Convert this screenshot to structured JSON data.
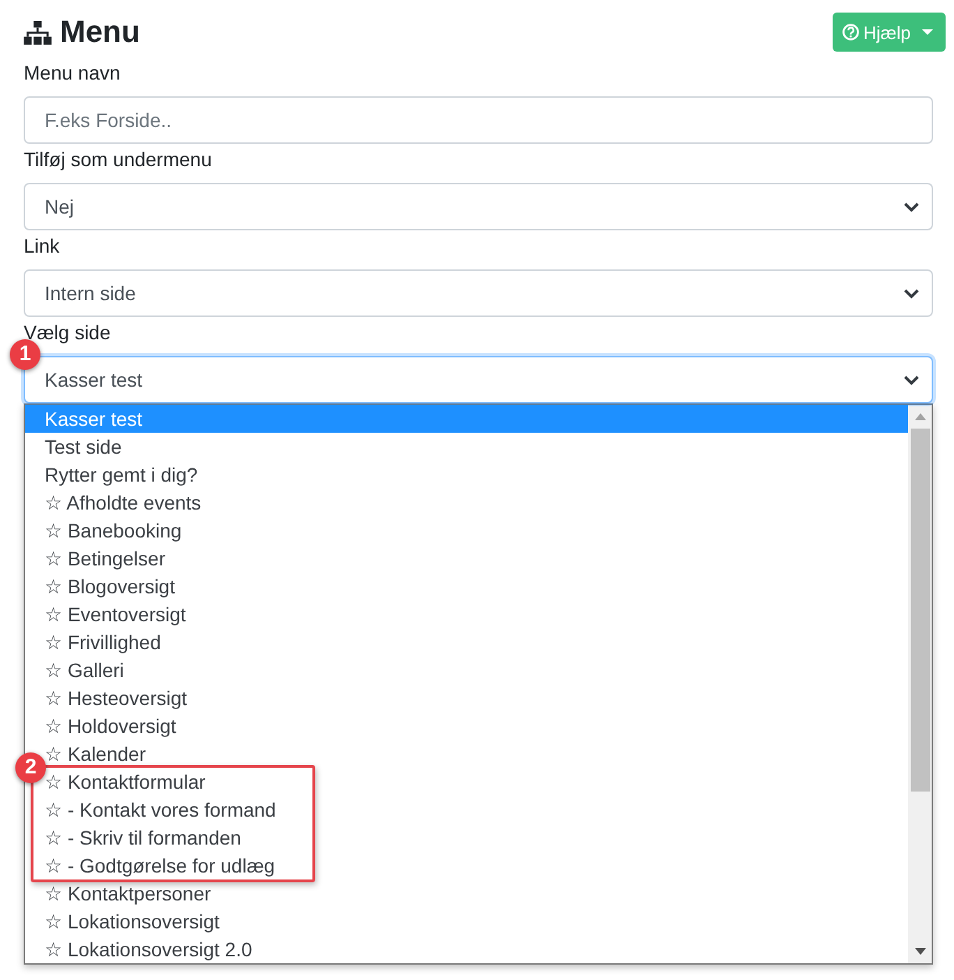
{
  "header": {
    "title": "Menu",
    "help_button": "Hjælp"
  },
  "fields": [
    {
      "kind": "input",
      "label": "Menu navn",
      "placeholder": "F.eks Forside..",
      "focused": false
    },
    {
      "kind": "select",
      "label": "Tilføj som undermenu",
      "value": "Nej",
      "focused": false
    },
    {
      "kind": "select",
      "label": "Link",
      "value": "Intern side",
      "focused": false
    },
    {
      "kind": "select",
      "label": "Vælg side",
      "value": "Kasser test",
      "focused": true,
      "badge": "1",
      "options": [
        {
          "kind": "option",
          "label": "Kasser test",
          "selected": true
        },
        {
          "kind": "option",
          "label": "Test side",
          "selected": false
        },
        {
          "kind": "option",
          "label": "Rytter gemt i dig?",
          "selected": false
        },
        {
          "kind": "option",
          "label": "☆ Afholdte events",
          "selected": false
        },
        {
          "kind": "option",
          "label": "☆ Banebooking",
          "selected": false
        },
        {
          "kind": "option",
          "label": "☆ Betingelser",
          "selected": false
        },
        {
          "kind": "option",
          "label": "☆ Blogoversigt",
          "selected": false
        },
        {
          "kind": "option",
          "label": "☆ Eventoversigt",
          "selected": false
        },
        {
          "kind": "option",
          "label": "☆ Frivillighed",
          "selected": false
        },
        {
          "kind": "option",
          "label": "☆ Galleri",
          "selected": false
        },
        {
          "kind": "option",
          "label": "☆ Hesteoversigt",
          "selected": false
        },
        {
          "kind": "option",
          "label": "☆ Holdoversigt",
          "selected": false
        },
        {
          "kind": "option",
          "label": "☆ Kalender",
          "selected": false
        },
        {
          "kind": "group",
          "highlighted": true,
          "badge": "2",
          "options": [
            {
              "kind": "option",
              "label": "☆ Kontaktformular",
              "selected": false
            },
            {
              "kind": "option",
              "label": "☆ - Kontakt vores formand",
              "selected": false
            },
            {
              "kind": "option",
              "label": "☆ - Skriv til formanden",
              "selected": false
            },
            {
              "kind": "option",
              "label": "☆ - Godtgørelse for udlæg",
              "selected": false
            }
          ]
        },
        {
          "kind": "option",
          "label": "☆ Kontaktpersoner",
          "selected": false
        },
        {
          "kind": "option",
          "label": "☆ Lokationsoversigt",
          "selected": false
        },
        {
          "kind": "option",
          "label": "☆ Lokationsoversigt 2.0",
          "selected": false
        }
      ]
    }
  ]
}
